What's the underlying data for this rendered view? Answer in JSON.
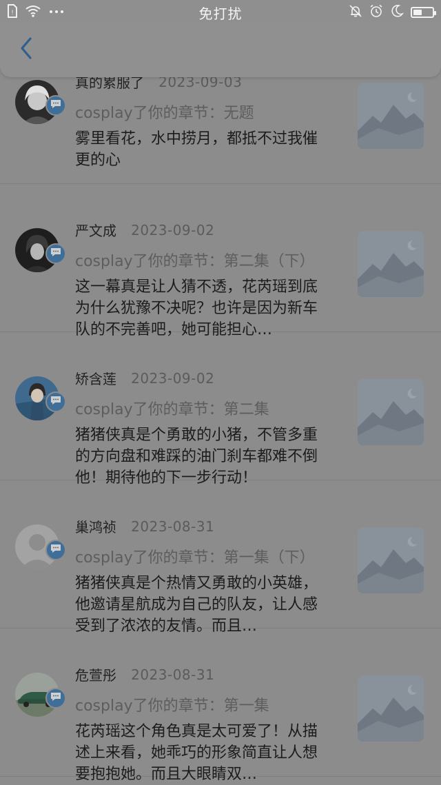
{
  "status_bar": {
    "title": "免打扰",
    "left_icons": [
      "sim-status-icon",
      "wifi-icon",
      "more-dots-icon"
    ],
    "right_icons": [
      "notification-mute-icon",
      "alarm-icon",
      "moon-icon",
      "battery-icon"
    ],
    "battery_level": 0.45
  },
  "header": {
    "back_icon": "chevron-left-icon"
  },
  "colors": {
    "accent": "#3f6e98",
    "overlay_background": "#8c8c8c",
    "text_primary": "#1c1c1c",
    "text_secondary": "#5d5d5d"
  },
  "items": [
    {
      "name": "真的累服了",
      "date": "2023-09-03",
      "action": "cosplay了你的章节：无题",
      "comment": "雾里看花，水中捞月，都抵不过我催更的心",
      "avatar": "dark-haired-character-avatar"
    },
    {
      "name": "严文成",
      "date": "2023-09-02",
      "action": "cosplay了你的章节：第二集（下）",
      "comment": "这一幕真是让人猜不透，花芮瑶到底为什么犹豫不决呢？也许是因为新车队的不完善吧，她可能担心…",
      "avatar": "dark-haired-character-avatar"
    },
    {
      "name": "矫含莲",
      "date": "2023-09-02",
      "action": "cosplay了你的章节：第二集",
      "comment": "猪猪侠真是个勇敢的小猪，不管多重的方向盘和难踩的油门刹车都难不倒他！期待他的下一步行动！",
      "avatar": "anime-boy-avatar"
    },
    {
      "name": "巢鸿祯",
      "date": "2023-08-31",
      "action": "cosplay了你的章节：第一集（下）",
      "comment": "猪猪侠真是个热情又勇敢的小英雄，他邀请星航成为自己的队友，让人感受到了浓浓的友情。而且…",
      "avatar": "default-user-avatar"
    },
    {
      "name": "危萱彤",
      "date": "2023-08-31",
      "action": "cosplay了你的章节：第一集",
      "comment": "花芮瑶这个角色真是太可爱了！从描述上来看，她乖巧的形象简直让人想要抱抱她。而且大眼睛双…",
      "avatar": "green-car-avatar"
    }
  ]
}
